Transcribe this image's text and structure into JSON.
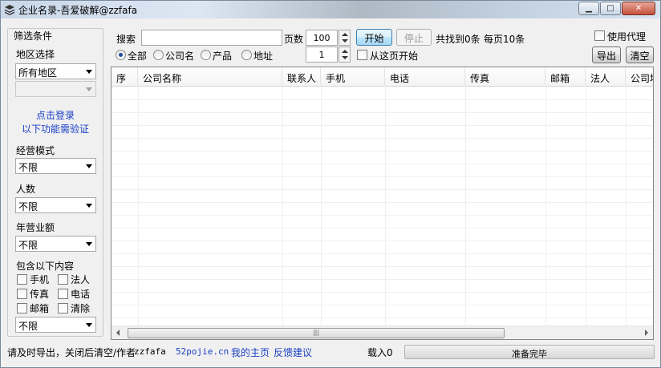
{
  "window": {
    "title": "企业名录-吾爱破解@zzfafa",
    "min_symbol": "▁",
    "max_symbol": "□",
    "close_symbol": "✕"
  },
  "filter": {
    "title": "筛选条件",
    "region_label": "地区选择",
    "region_value": "所有地区",
    "subregion_value": "",
    "login_link": "点击登录",
    "login_note": "以下功能需验证",
    "mode_label": "经营模式",
    "mode_value": "不限",
    "staff_label": "人数",
    "staff_value": "不限",
    "revenue_label": "年营业额",
    "revenue_value": "不限",
    "contains_label": "包含以下内容",
    "contains_items": [
      "手机",
      "法人",
      "传真",
      "电话",
      "邮箱",
      "清除"
    ],
    "contains_value": "不限"
  },
  "search": {
    "label": "搜索",
    "value": "",
    "pages_label": "页数",
    "pages_value": "100",
    "start_label": "开始",
    "stop_label": "停止",
    "found_text": "共找到0条",
    "per_page_text": "每页10条",
    "start_page_value": "1",
    "from_page_label": "从这页开始",
    "radios": [
      "全部",
      "公司名",
      "产品",
      "地址"
    ],
    "selected_radio": "全部",
    "proxy_label": "使用代理",
    "export_label": "导出",
    "clear_label": "清空"
  },
  "table": {
    "columns": [
      "序",
      "公司名称",
      "联系人",
      "手机",
      "电话",
      "传真",
      "邮箱",
      "法人",
      "公司地址"
    ],
    "rows": []
  },
  "status": {
    "note": "请及时导出，关闭后清空/作者",
    "author": "zzfafa",
    "site": "52pojie.cn",
    "homepage_link": "我的主页",
    "feedback_link": "反馈建议",
    "loaded": "载入0",
    "progress_text": "准备完毕",
    "progress": 0
  }
}
